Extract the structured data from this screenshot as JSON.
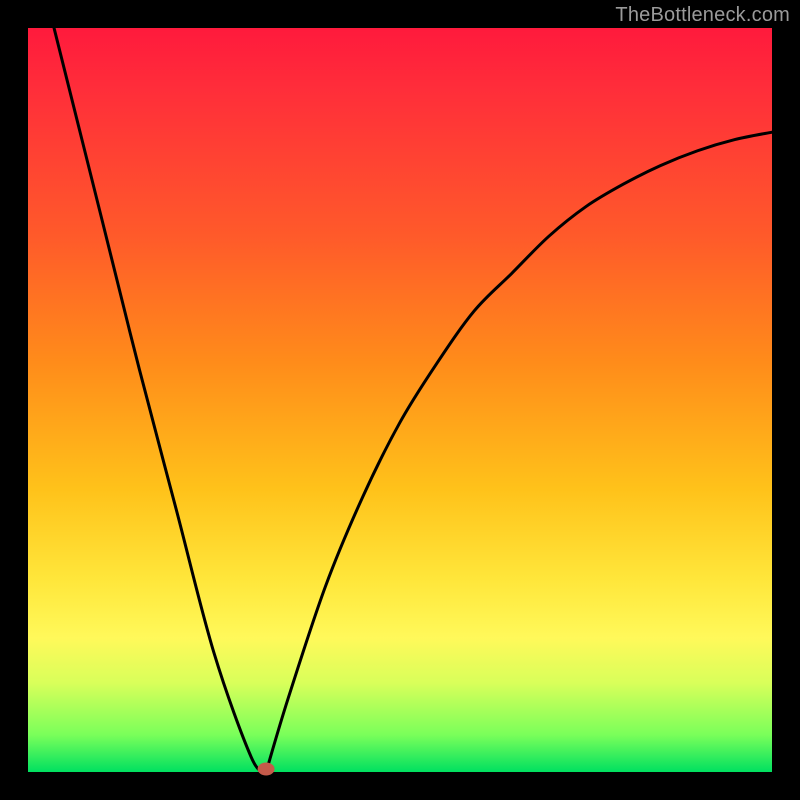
{
  "watermark": "TheBottleneck.com",
  "chart_data": {
    "type": "line",
    "title": "",
    "xlabel": "",
    "ylabel": "",
    "xlim": [
      0,
      100
    ],
    "ylim": [
      0,
      100
    ],
    "background_gradient": {
      "top": "#ff1a3c",
      "mid1": "#ff8c1a",
      "mid2": "#ffe63a",
      "bottom": "#00e060"
    },
    "series": [
      {
        "name": "left-branch",
        "comment": "steep descending line from top-left toward minimum",
        "x": [
          3.5,
          10,
          15,
          20,
          25,
          30,
          32
        ],
        "y": [
          100,
          74,
          54,
          35,
          16,
          2,
          0
        ]
      },
      {
        "name": "right-branch",
        "comment": "concave-down curve rising from minimum to upper-right, decelerating",
        "x": [
          32,
          35,
          40,
          45,
          50,
          55,
          60,
          65,
          70,
          75,
          80,
          85,
          90,
          95,
          100
        ],
        "y": [
          0,
          10,
          25,
          37,
          47,
          55,
          62,
          67,
          72,
          76,
          79,
          81.5,
          83.5,
          85,
          86
        ]
      }
    ],
    "minimum_marker": {
      "x": 32,
      "y": 0,
      "color": "#c45a4a"
    },
    "curve_stroke": "#000000",
    "curve_stroke_width": 3
  }
}
